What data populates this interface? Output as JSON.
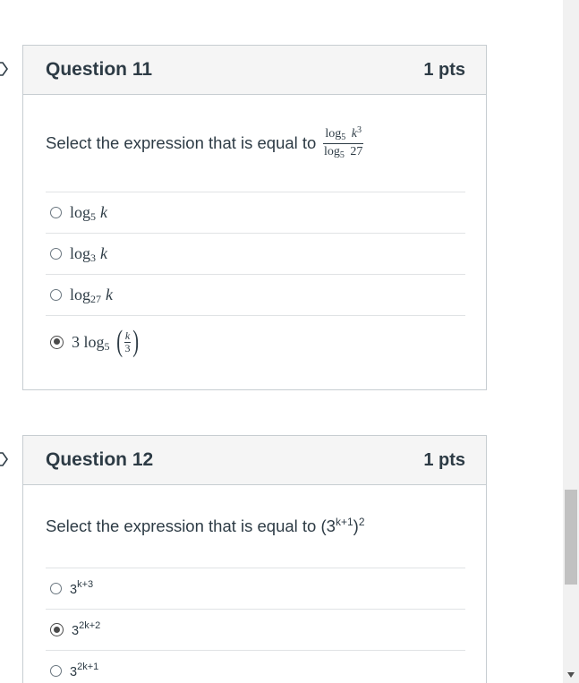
{
  "questions": [
    {
      "title": "Question 11",
      "points": "1 pts",
      "prompt": "Select the expression that is equal to",
      "prompt_math": {
        "num_log": "log",
        "num_base": "5",
        "num_var": "k",
        "num_exp": "3",
        "den_log": "log",
        "den_base": "5",
        "den_val": "27"
      },
      "answers": [
        {
          "log": "log",
          "base": "5",
          "var": "k",
          "selected": false
        },
        {
          "log": "log",
          "base": "3",
          "var": "k",
          "selected": false
        },
        {
          "log": "log",
          "base": "27",
          "var": "k",
          "selected": false
        },
        {
          "coef": "3",
          "log": "log",
          "base": "5",
          "frac_num": "k",
          "frac_den": "3",
          "selected": true
        }
      ]
    },
    {
      "title": "Question 12",
      "points": "1 pts",
      "prompt": "Select the expression that is equal to (3",
      "prompt_sup": "k+1",
      "prompt_mid": ")",
      "prompt_sup2": "2",
      "answers": [
        {
          "base": "3",
          "exp": "k+3",
          "selected": false
        },
        {
          "base": "3",
          "exp": "2k+2",
          "selected": true
        },
        {
          "base": "3",
          "exp": "2k+1",
          "selected": false
        }
      ]
    }
  ],
  "icons": {
    "bookmark": "bookmark-icon",
    "radio": "radio-icon",
    "scroll_down": "chevron-down-icon"
  },
  "colors": {
    "header_bg": "#f5f5f5",
    "border": "#c7cdd1",
    "text": "#2d3b45"
  }
}
